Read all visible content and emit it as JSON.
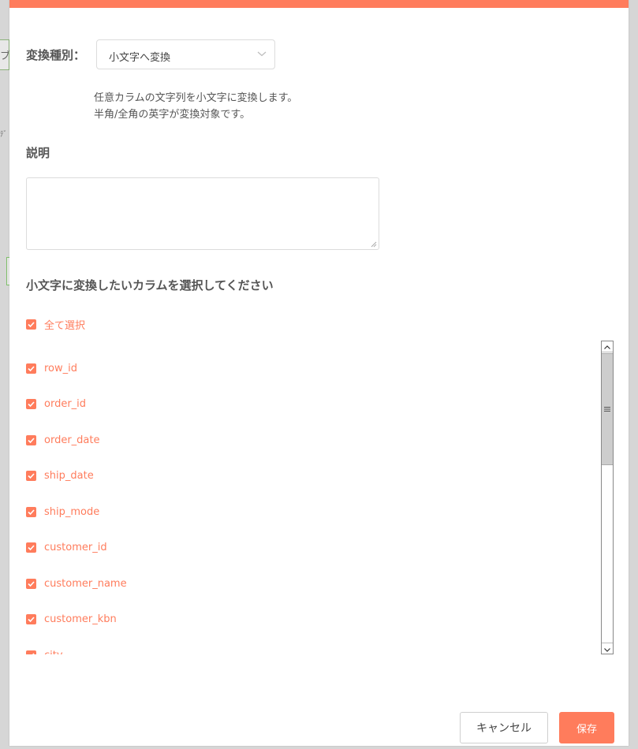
{
  "background": {
    "fragment_1": "ブ",
    "fragment_2": "ﾃﾞ"
  },
  "colors": {
    "accent": "#ff7c5c",
    "text": "#555555"
  },
  "form": {
    "type_label": "変換種別：",
    "type_select_value": "小文字へ変換",
    "description_lines": [
      "任意カラムの文字列を小文字に変換します。",
      "半角/全角の英字が変換対象です。"
    ],
    "notes_title": "説明",
    "notes_value": "",
    "columns_title": "小文字に変換したいカラムを選択してください",
    "select_all_label": "全て選択",
    "select_all_checked": true
  },
  "columns": [
    {
      "name": "row_id",
      "checked": true
    },
    {
      "name": "order_id",
      "checked": true
    },
    {
      "name": "order_date",
      "checked": true
    },
    {
      "name": "ship_date",
      "checked": true
    },
    {
      "name": "ship_mode",
      "checked": true
    },
    {
      "name": "customer_id",
      "checked": true
    },
    {
      "name": "customer_name",
      "checked": true
    },
    {
      "name": "customer_kbn",
      "checked": true
    },
    {
      "name": "city",
      "checked": true
    }
  ],
  "buttons": {
    "cancel": "キャンセル",
    "save": "保存"
  },
  "icons": {
    "select_chevron": "chevron-down-icon",
    "checkbox": "check-icon",
    "scroll_up": "arrow-up-icon",
    "scroll_down": "arrow-down-icon",
    "scroll_grip": "grip-icon",
    "textarea_resize": "resize-grip-icon"
  }
}
